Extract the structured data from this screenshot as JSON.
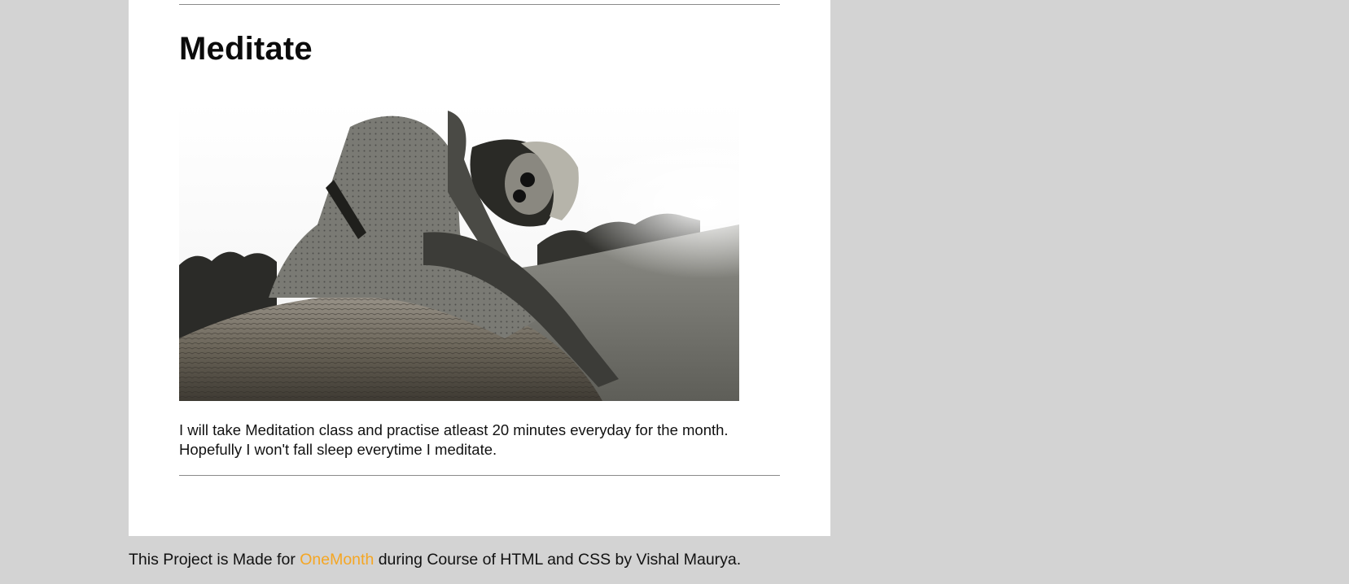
{
  "post": {
    "title": "Meditate",
    "description_line1": "I will take Meditation class and practise atleast 20 minutes everyday for the month.",
    "description_line2": "Hopefully I won't fall sleep everytime I meditate.",
    "image": {
      "alt": "woman sitting on hay bale"
    }
  },
  "footer": {
    "prefix": "This Project is Made for ",
    "link_label": "OneMonth",
    "suffix": " during Course of HTML and CSS by Vishal Maurya."
  },
  "colors": {
    "page_background": "#d3d3d3",
    "card_background": "#ffffff",
    "link": "#f5a623",
    "rule": "#8a8a8a"
  }
}
